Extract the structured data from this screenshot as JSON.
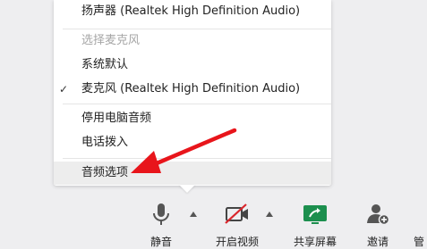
{
  "menu": {
    "speaker_item": "扬声器 (Realtek High Definition Audio)",
    "mic_header": "选择麦克风",
    "mic_default": "系统默认",
    "mic_realtek": "麦克风 (Realtek High Definition Audio)",
    "stop_computer_audio": "停用电脑音频",
    "phone_dial_in": "电话拨入",
    "audio_options": "音频选项"
  },
  "toolbar": {
    "mute_label": "静音",
    "video_label": "开启视频",
    "share_label": "共享屏幕",
    "invite_label": "邀请",
    "manage_label_partial": "管"
  },
  "colors": {
    "arrow": "#e8151b",
    "share_green": "#1c8f4e",
    "video_slash": "#d9262c",
    "highlight": "#ededed"
  },
  "icons": {
    "mute": "microphone-icon",
    "video": "video-camera-off-icon",
    "share": "share-screen-icon",
    "invite": "add-user-icon"
  }
}
